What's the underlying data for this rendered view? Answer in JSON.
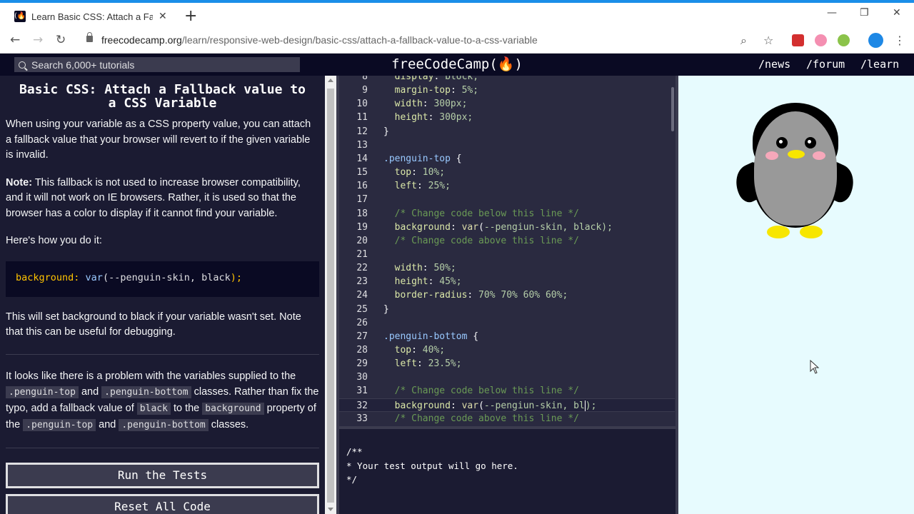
{
  "browser": {
    "tab_title": "Learn Basic CSS: Attach a Fallback",
    "tab_favicon": "(🔥)",
    "url_host": "freecodecamp.org",
    "url_path": "/learn/responsive-web-design/basic-css/attach-a-fallback-value-to-a-css-variable",
    "icons": {
      "close": "✕",
      "new_tab": "+",
      "minimize": "—",
      "restore": "❐",
      "window_close": "✕",
      "back": "←",
      "forward": "→",
      "reload": "↻",
      "zoom": "⌕",
      "star": "☆",
      "menu": "⋮"
    },
    "accent_color": "#1a8ee8"
  },
  "fcc_nav": {
    "search_placeholder": "Search 6,000+ tutorials",
    "logo": "freeCodeCamp(🔥)",
    "links": [
      "/news",
      "/forum",
      "/learn"
    ]
  },
  "lesson": {
    "title": "Basic CSS: Attach a Fallback value to a CSS Variable",
    "p1": "When using your variable as a CSS property value, you can attach a fallback value that your browser will revert to if the given variable is invalid.",
    "note_label": "Note:",
    "note_text": " This fallback is not used to increase browser compatibility, and it will not work on IE browsers. Rather, it is used so that the browser has a color to display if it cannot find your variable.",
    "p3": "Here's how you do it:",
    "example": {
      "prop": "background:",
      "fn": "var",
      "open": "(--penguin-skin, black",
      "close": ");"
    },
    "p4": "This will set background to black if your variable wasn't set. Note that this can be useful for debugging.",
    "task": {
      "t1": "It looks like there is a problem with the variables supplied to the ",
      "c1": ".penguin-top",
      "t2": " and ",
      "c2": ".penguin-bottom",
      "t3": " classes. Rather than fix the typo, add a fallback value of ",
      "c3": "black",
      "t4": " to the ",
      "c4": "background",
      "t5": " property of the ",
      "c5": ".penguin-top",
      "t6": " and ",
      "c6": ".penguin-bottom",
      "t7": " classes."
    },
    "run_button": "Run the Tests",
    "reset_button": "Reset All Code"
  },
  "editor": {
    "lines": [
      {
        "n": "8",
        "code": "    display: block;"
      },
      {
        "n": "9",
        "code": "    margin-top: 5%;"
      },
      {
        "n": "10",
        "code": "    width: 300px;"
      },
      {
        "n": "11",
        "code": "    height: 300px;"
      },
      {
        "n": "12",
        "code": "  }"
      },
      {
        "n": "13",
        "code": ""
      },
      {
        "n": "14",
        "code": "  .penguin-top {"
      },
      {
        "n": "15",
        "code": "    top: 10%;"
      },
      {
        "n": "16",
        "code": "    left: 25%;"
      },
      {
        "n": "17",
        "code": ""
      },
      {
        "n": "18",
        "code": "    /* Change code below this line */"
      },
      {
        "n": "19",
        "code": "    background: var(--pengiun-skin, black);"
      },
      {
        "n": "20",
        "code": "    /* Change code above this line */"
      },
      {
        "n": "21",
        "code": ""
      },
      {
        "n": "22",
        "code": "    width: 50%;"
      },
      {
        "n": "23",
        "code": "    height: 45%;"
      },
      {
        "n": "24",
        "code": "    border-radius: 70% 70% 60% 60%;"
      },
      {
        "n": "25",
        "code": "  }"
      },
      {
        "n": "26",
        "code": ""
      },
      {
        "n": "27",
        "code": "  .penguin-bottom {"
      },
      {
        "n": "28",
        "code": "    top: 40%;"
      },
      {
        "n": "29",
        "code": "    left: 23.5%;"
      },
      {
        "n": "30",
        "code": ""
      },
      {
        "n": "31",
        "code": "    /* Change code below this line */"
      },
      {
        "n": "32",
        "code": "    background: var(--pengiun-skin, bl);"
      },
      {
        "n": "33",
        "code": "    /* Change code above this line */"
      }
    ],
    "active_line": "32"
  },
  "console": {
    "output": "/**\n* Your test output will go here.\n*/"
  },
  "preview": {
    "background": "#e7fbfe",
    "penguin_colors": {
      "skin": "#999999",
      "outline": "#000000",
      "beak": "#f7e600",
      "cheek": "#f6a8ba"
    }
  }
}
